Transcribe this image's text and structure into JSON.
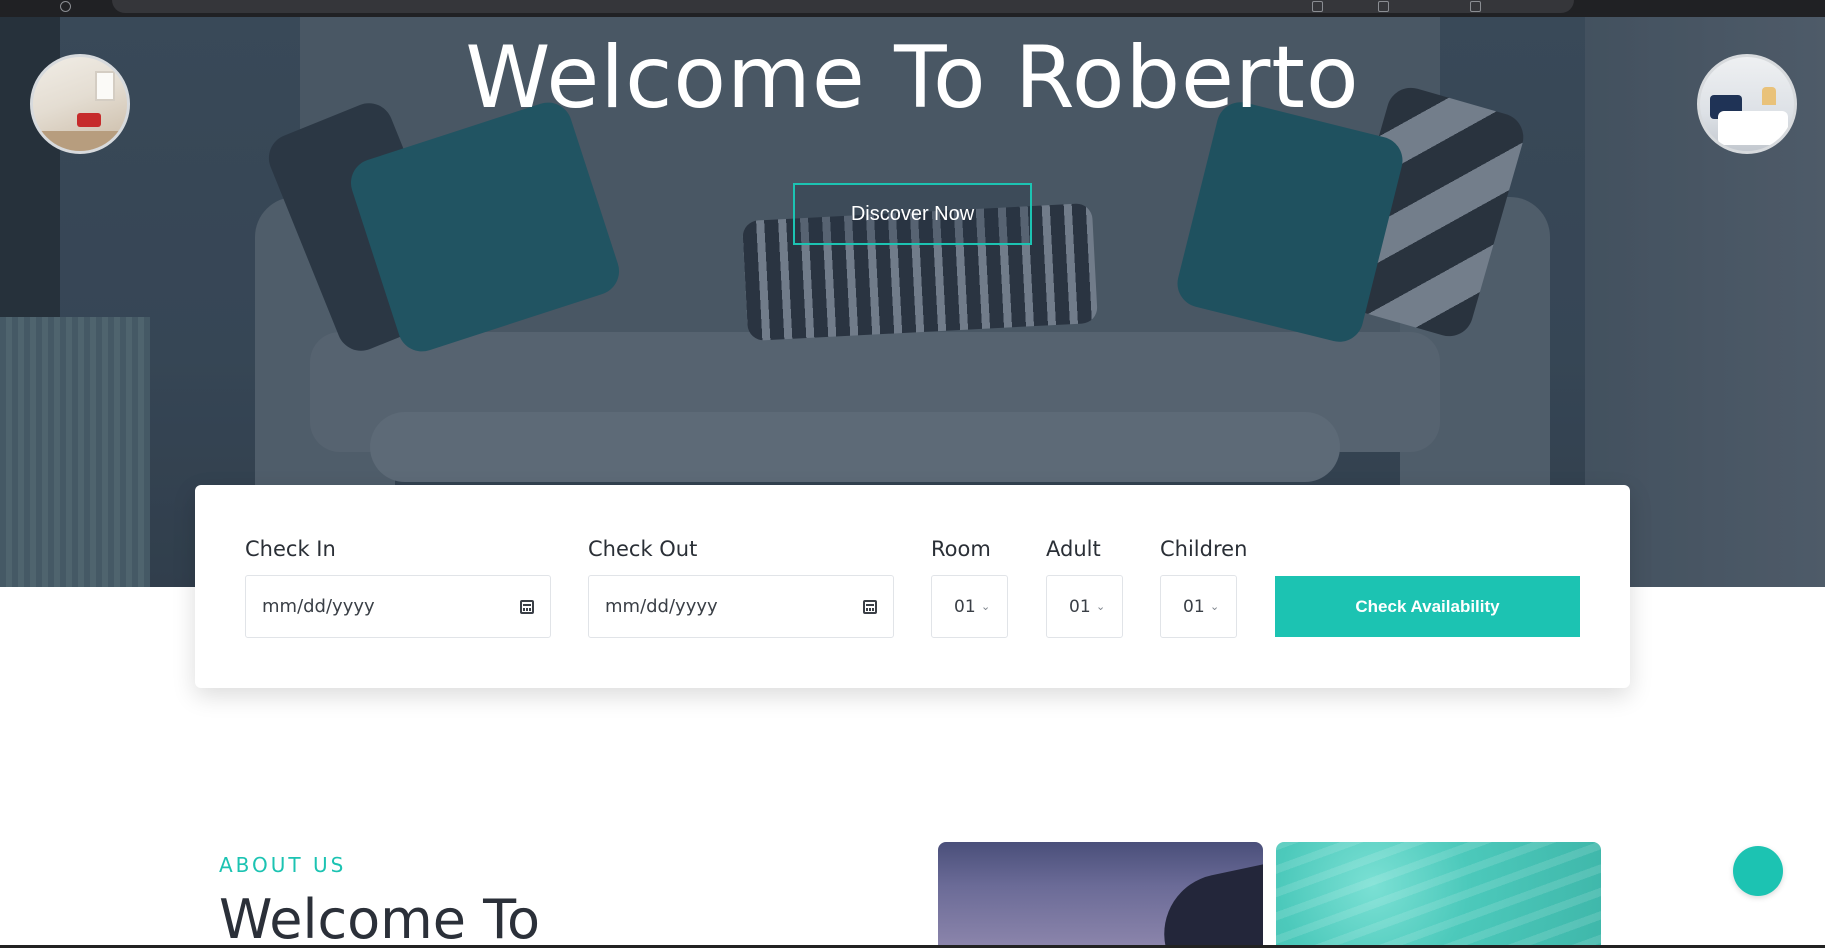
{
  "hero": {
    "title": "Welcome To Roberto",
    "cta_label": "Discover Now"
  },
  "booking": {
    "check_in": {
      "label": "Check In",
      "placeholder": "mm/dd/yyyy"
    },
    "check_out": {
      "label": "Check Out",
      "placeholder": "mm/dd/yyyy"
    },
    "room": {
      "label": "Room",
      "value": "01"
    },
    "adult": {
      "label": "Adult",
      "value": "01"
    },
    "children": {
      "label": "Children",
      "value": "01"
    },
    "submit_label": "Check Availability"
  },
  "about": {
    "kicker": "ABOUT US",
    "title": "Welcome To"
  },
  "colors": {
    "accent": "#1cc3b2",
    "heading": "#2b3039"
  },
  "icons": {
    "calendar": "calendar-icon",
    "chevron": "chevron-down-icon"
  }
}
